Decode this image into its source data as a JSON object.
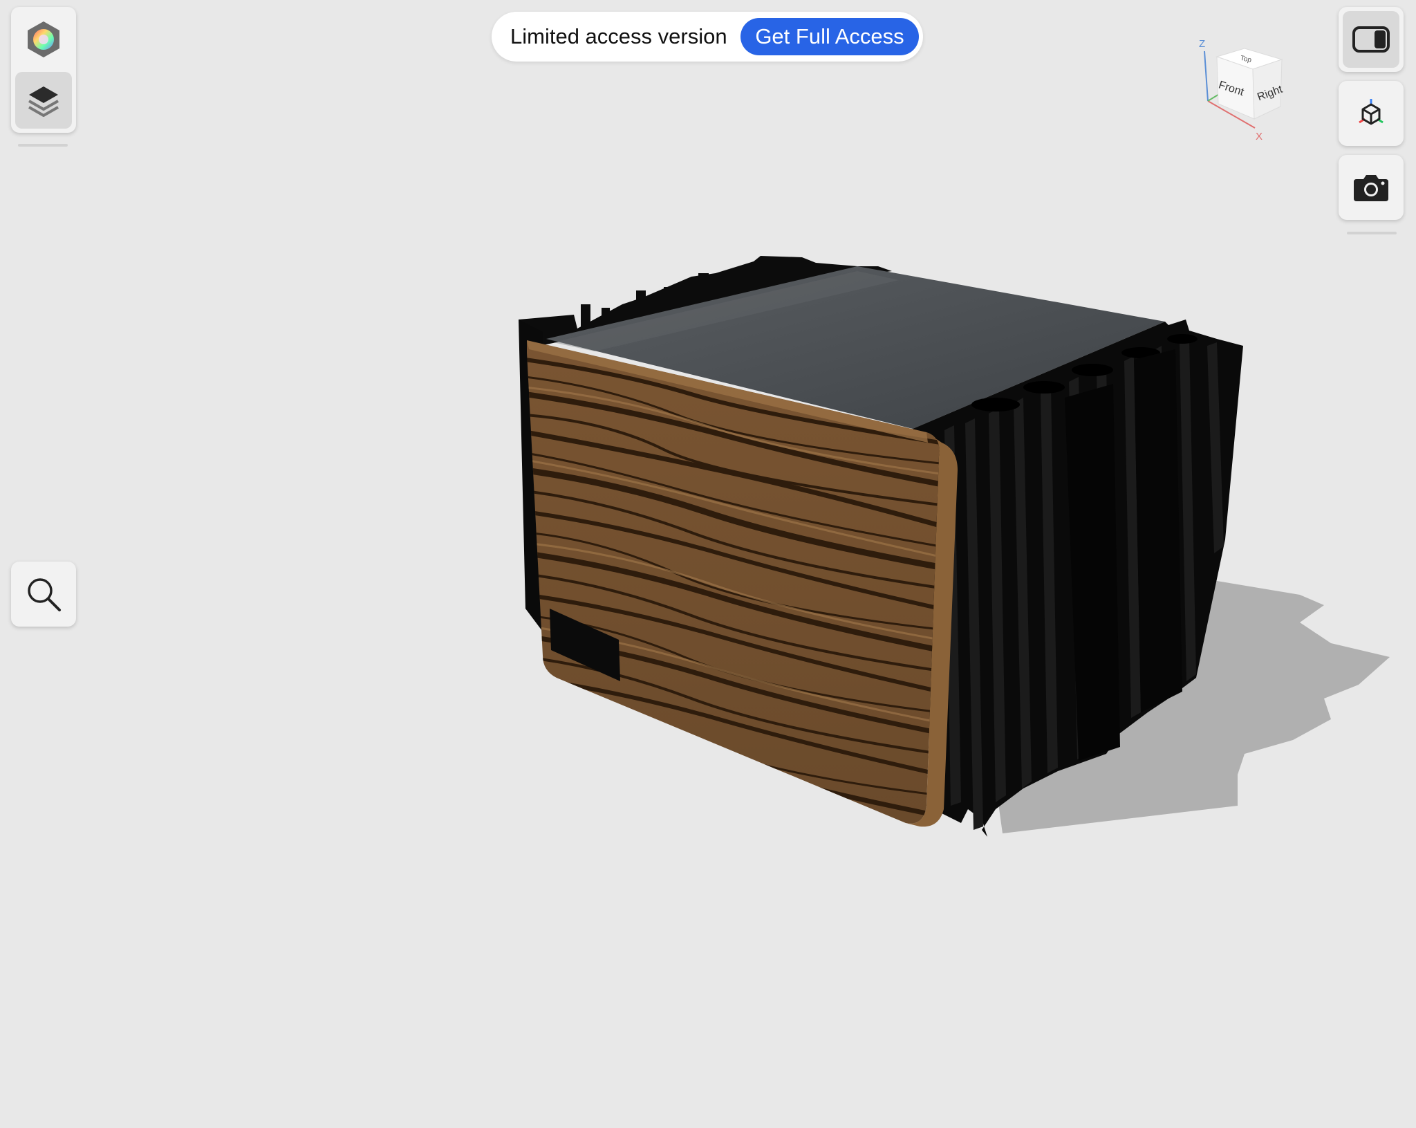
{
  "banner": {
    "text": "Limited access version",
    "button_label": "Get Full Access",
    "button_color": "#2864e6"
  },
  "left_toolbar": {
    "items": [
      {
        "icon": "appearance-color-hex-icon",
        "active": false
      },
      {
        "icon": "layers-icon",
        "active": true
      }
    ],
    "zoom_icon": "search-icon"
  },
  "right_toolbar": {
    "items": [
      {
        "icon": "panel-toggle-icon",
        "active": true
      },
      {
        "icon": "explode-view-cube-icon",
        "active": false
      },
      {
        "icon": "camera-icon",
        "active": false
      }
    ]
  },
  "view_cube": {
    "faces": {
      "top": "Top",
      "front": "Front",
      "right": "Right"
    },
    "axes": {
      "z": "Z",
      "x": "X"
    },
    "axis_colors": {
      "z": "#5b8fd6",
      "x": "#e07070",
      "y": "#66bb66"
    }
  },
  "model": {
    "description_colors": {
      "wood": "#6b4a2a",
      "top_plate": "#4a4e52",
      "fins": "#0d0d0d",
      "shadow": "#b4b4b4"
    }
  }
}
